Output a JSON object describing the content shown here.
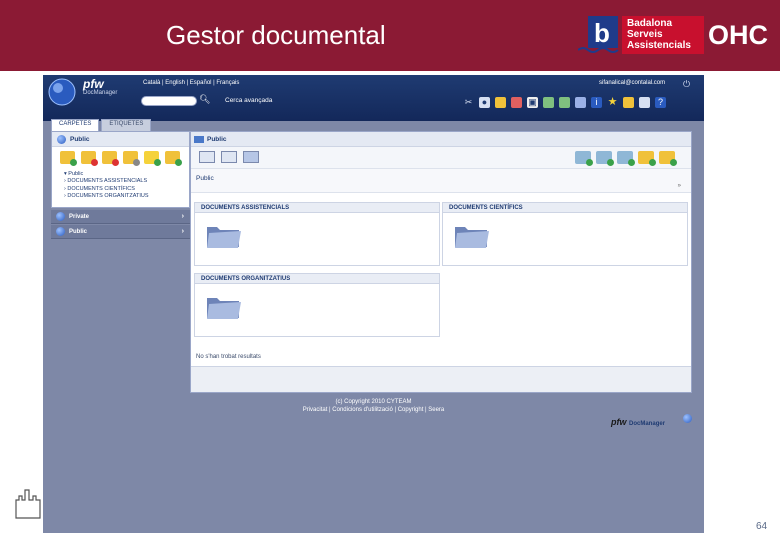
{
  "slide": {
    "title": "Gestor documental",
    "page_number": "64",
    "logos": {
      "b_letter": "b",
      "badalona_lines": [
        "Badalona",
        "Serveis",
        "Assistencials"
      ],
      "ohc": "OHC"
    }
  },
  "app": {
    "brand": "pfw",
    "brand_sub": "DocManager",
    "languages": "Català | English | Español | Français",
    "user": "sifanalical@contalal.com",
    "search_placeholder": "",
    "advanced_search": "Cerca avançada",
    "tabs": [
      {
        "label": "CARPETES",
        "active": true
      },
      {
        "label": "ETIQUETES",
        "active": false
      }
    ],
    "left_panel": {
      "header": "Public",
      "tree": [
        "▾ Public",
        "› DOCUMENTS ASSISTENCIALS",
        "› DOCUMENTS CIENTÍFICS",
        "› DOCUMENTS ORGANITZATIUS"
      ],
      "sections": [
        {
          "label": "Private"
        },
        {
          "label": "Public"
        }
      ]
    },
    "main_panel": {
      "header": "Public",
      "breadcrumb": "Public",
      "expand_glyph": "»",
      "folders": [
        {
          "name": "DOCUMENTS ASSISTENCIALS"
        },
        {
          "name": "DOCUMENTS CIENTÍFICS"
        },
        {
          "name": "DOCUMENTS ORGANITZATIUS"
        }
      ],
      "status": "No s'han trobat resultats"
    },
    "footer": {
      "copyright": "(c) Copyright 2010 CYTEAM",
      "links": "Privacitat | Condicions d'utilització | Copyright | Seera"
    },
    "colors": {
      "header_band": "#8b1a34",
      "app_background": "#7e88a7",
      "topbar": "#1f3b72"
    }
  }
}
